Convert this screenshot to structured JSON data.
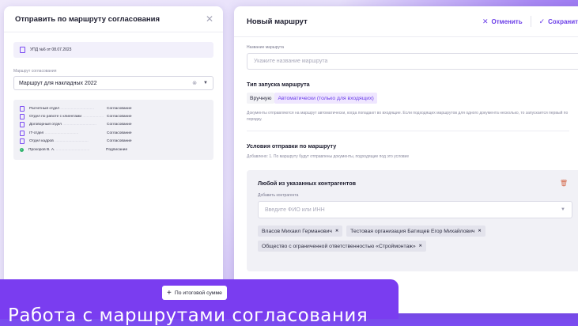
{
  "colors": {
    "accent": "#7a3df0",
    "link": "#6a3de8",
    "success": "#2fb36b",
    "glow": "#ffb400"
  },
  "left": {
    "title": "Отправить по маршруту согласования",
    "close_icon": "close-icon",
    "document": "УПД №6 от 08.07.2023",
    "route_label": "Маршрут согласования",
    "route_value": "Маршрут для накладных 2022",
    "steps": [
      {
        "name": "Расчетный отдел",
        "action": "Согласование",
        "icon": "document-icon"
      },
      {
        "name": "Отдел по работе с клиентами",
        "action": "Согласование",
        "icon": "document-icon"
      },
      {
        "name": "Договорный отдел",
        "action": "Согласование",
        "icon": "document-icon"
      },
      {
        "name": "IT-отдел",
        "action": "Согласование",
        "icon": "document-icon"
      },
      {
        "name": "Отдел кадров",
        "action": "Согласование",
        "icon": "document-icon"
      },
      {
        "name": "Прохоров В. А.",
        "action": "Подписание",
        "icon": "check-icon"
      }
    ]
  },
  "right": {
    "title": "Новый маршрут",
    "cancel_label": "Отменить",
    "save_label": "Сохранить",
    "name_label": "Название маршрута",
    "name_placeholder": "Укажите название маршрута",
    "launch_title": "Тип запуска маршрута",
    "launch_options": [
      "Вручную",
      "Автоматически (только для входящих)"
    ],
    "launch_hint": "Документы отправляются на маршрут автоматически, когда попадают во входящие. Если подходящих маршрутов для одного документа несколько, то запускается первый по порядку.",
    "conditions_title": "Условия отправки по маршруту",
    "conditions_hint": "Добавлено: 1. По маршруту будут отправлены документы, подходящие под это условие",
    "condition": {
      "title": "Любой из указанных контрагентов",
      "add_label": "Добавить контрагента",
      "add_placeholder": "Введите ФИО или ИНН",
      "tags": [
        "Власов Михаил Германович",
        "Тестовая организация Батищев Егор Михайлович",
        "Общество с ограниченной ответственностью «Строймонтаж»"
      ]
    },
    "add_condition_label": "По итоговой сумме"
  },
  "banner": {
    "text": "Работа с маршрутами согласования"
  }
}
